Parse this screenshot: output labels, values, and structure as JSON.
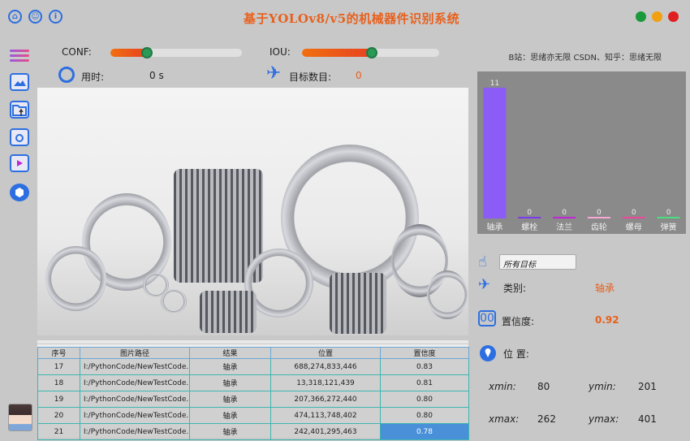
{
  "header": {
    "title": "基于YOLOv8/v5的机械器件识别系统",
    "icons": [
      "home-icon",
      "user-icon",
      "info-icon"
    ],
    "window_buttons": [
      {
        "name": "minimize",
        "color": "#1a9a3a"
      },
      {
        "name": "maximize",
        "color": "#f0a010"
      },
      {
        "name": "close",
        "color": "#e02020"
      }
    ]
  },
  "params": {
    "conf_label": "CONF:",
    "conf_value": 0.25,
    "iou_label": "IOU:",
    "iou_value": 0.5,
    "time_label": "用时:",
    "time_value": "0 s",
    "count_label": "目标数目:",
    "count_value": "0"
  },
  "credit": "B站：思绪亦无限 CSDN、知乎：思绪无限",
  "table": {
    "headers": [
      "序号",
      "图片路径",
      "结果",
      "位置",
      "置信度"
    ],
    "rows": [
      {
        "id": "17",
        "path": "I:/PythonCode/NewTestCode...",
        "result": "轴承",
        "position": "688,274,833,446",
        "conf": "0.83"
      },
      {
        "id": "18",
        "path": "I:/PythonCode/NewTestCode...",
        "result": "轴承",
        "position": "13,318,121,439",
        "conf": "0.81"
      },
      {
        "id": "19",
        "path": "I:/PythonCode/NewTestCode...",
        "result": "轴承",
        "position": "207,366,272,440",
        "conf": "0.80"
      },
      {
        "id": "20",
        "path": "I:/PythonCode/NewTestCode...",
        "result": "轴承",
        "position": "474,113,748,402",
        "conf": "0.80"
      },
      {
        "id": "21",
        "path": "I:/PythonCode/NewTestCode...",
        "result": "轴承",
        "position": "242,401,295,463",
        "conf": "0.78"
      }
    ]
  },
  "chart_data": {
    "type": "bar",
    "categories": [
      "轴承",
      "螺栓",
      "法兰",
      "齿轮",
      "螺母",
      "弹簧"
    ],
    "values": [
      11,
      0,
      0,
      0,
      0,
      0
    ],
    "colors": [
      "#8b5cf6",
      "#7c3aed",
      "#c026d3",
      "#f9a8d4",
      "#ec4899",
      "#4ade80"
    ],
    "ylim": [
      0,
      11
    ]
  },
  "detail": {
    "filter_value": "所有目标",
    "class_label": "类别:",
    "class_value": "轴承",
    "conf_label": "置信度:",
    "conf_value": "0.92",
    "pos_label": "位 置:",
    "xmin_label": "xmin:",
    "xmin_value": "80",
    "ymin_label": "ymin:",
    "ymin_value": "201",
    "xmax_label": "xmax:",
    "xmax_value": "262",
    "ymax_label": "ymax:",
    "ymax_value": "401"
  }
}
